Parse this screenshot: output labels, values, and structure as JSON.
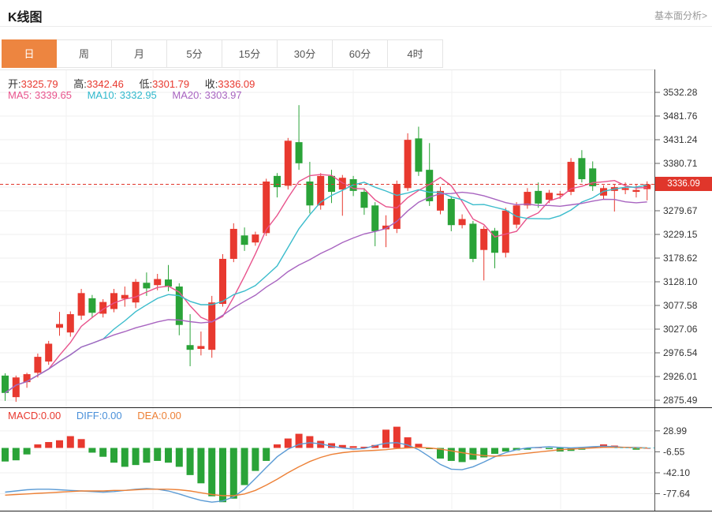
{
  "header": {
    "title": "K线图",
    "link": "基本面分析>"
  },
  "tabs": {
    "items": [
      {
        "label": "日",
        "active": true
      },
      {
        "label": "周",
        "active": false
      },
      {
        "label": "月",
        "active": false
      },
      {
        "label": "5分",
        "active": false
      },
      {
        "label": "15分",
        "active": false
      },
      {
        "label": "30分",
        "active": false
      },
      {
        "label": "60分",
        "active": false
      },
      {
        "label": "4时",
        "active": false
      }
    ]
  },
  "ohlc": {
    "open_label": "开:",
    "open_value": "3325.79",
    "high_label": "高:",
    "high_value": "3342.46",
    "low_label": "低:",
    "low_value": "3301.79",
    "close_label": "收:",
    "close_value": "3336.09"
  },
  "ma": {
    "ma5_label": "MA5:",
    "ma5_value": "3339.65",
    "ma10_label": "MA10:",
    "ma10_value": "3332.95",
    "ma20_label": "MA20:",
    "ma20_value": "3303.97"
  },
  "macd_info": {
    "macd_label": "MACD:",
    "macd_value": "0.00",
    "diff_label": "DIFF:",
    "diff_value": "0.00",
    "dea_label": "DEA:",
    "dea_value": "0.00"
  },
  "price_tag": "3336.09",
  "colors": {
    "up": "#e8392f",
    "down": "#2aa338",
    "ma5": "#e8538c",
    "ma10": "#3bbccc",
    "ma20": "#a864c0",
    "diff": "#5b9bd5",
    "dea": "#ed8137",
    "tab_accent": "#ED8540",
    "price_line": "#e0362b",
    "grid": "#efefef",
    "axis": "#666666",
    "zero_dash": "#62c9d8"
  },
  "chart_data": [
    {
      "type": "candlestick",
      "title": "K线图",
      "legend": [
        "MA5",
        "MA10",
        "MA20"
      ],
      "current_price": 3336.09,
      "x_gridlines": [
        84,
        194,
        304,
        448,
        573,
        711
      ],
      "y_ticks": [
        {
          "value": 3532.28,
          "label": "3532.28"
        },
        {
          "value": 3481.76,
          "label": "3481.76"
        },
        {
          "value": 3431.24,
          "label": "3431.24"
        },
        {
          "value": 3380.71,
          "label": "3380.71"
        },
        {
          "value": 3330.19,
          "label": ""
        },
        {
          "value": 3279.67,
          "label": "3279.67"
        },
        {
          "value": 3229.15,
          "label": "3229.15"
        },
        {
          "value": 3178.62,
          "label": "3178.62"
        },
        {
          "value": 3128.1,
          "label": "3128.10"
        },
        {
          "value": 3077.58,
          "label": "3077.58"
        },
        {
          "value": 3027.06,
          "label": "3027.06"
        },
        {
          "value": 2976.54,
          "label": "2976.54"
        },
        {
          "value": 2926.01,
          "label": "2926.01"
        },
        {
          "value": 2875.49,
          "label": "2875.49"
        }
      ],
      "candles_ohlc_hl_format": "[open, high, low, close]",
      "candles": [
        [
          2928,
          2933,
          2874,
          2891
        ],
        [
          2882,
          2928,
          2872,
          2924
        ],
        [
          2914,
          2934,
          2902,
          2931
        ],
        [
          2934,
          2975,
          2924,
          2968
        ],
        [
          2958,
          3002,
          2951,
          2996
        ],
        [
          3030,
          3064,
          3013,
          3038
        ],
        [
          3020,
          3065,
          3011,
          3059
        ],
        [
          3056,
          3113,
          3047,
          3104
        ],
        [
          3093,
          3100,
          3051,
          3062
        ],
        [
          3060,
          3091,
          3052,
          3085
        ],
        [
          3070,
          3113,
          3063,
          3104
        ],
        [
          3092,
          3118,
          3075,
          3100
        ],
        [
          3084,
          3134,
          3072,
          3128
        ],
        [
          3126,
          3148,
          3098,
          3114
        ],
        [
          3121,
          3145,
          3110,
          3134
        ],
        [
          3133,
          3164,
          3108,
          3118
        ],
        [
          3118,
          3125,
          3014,
          3036
        ],
        [
          2993,
          3059,
          2948,
          2983
        ],
        [
          2985,
          3022,
          2971,
          2991
        ],
        [
          2983,
          3098,
          2966,
          3084
        ],
        [
          3081,
          3187,
          3075,
          3177
        ],
        [
          3177,
          3253,
          3170,
          3241
        ],
        [
          3227,
          3244,
          3194,
          3207
        ],
        [
          3212,
          3235,
          3205,
          3229
        ],
        [
          3232,
          3348,
          3226,
          3342
        ],
        [
          3354,
          3360,
          3308,
          3330
        ],
        [
          3333,
          3435,
          3325,
          3429
        ],
        [
          3426,
          3505,
          3367,
          3381
        ],
        [
          3342,
          3384,
          3274,
          3291
        ],
        [
          3291,
          3360,
          3282,
          3354
        ],
        [
          3354,
          3367,
          3296,
          3320
        ],
        [
          3325,
          3356,
          3269,
          3350
        ],
        [
          3347,
          3354,
          3311,
          3322
        ],
        [
          3320,
          3328,
          3271,
          3286
        ],
        [
          3291,
          3298,
          3204,
          3236
        ],
        [
          3240,
          3270,
          3202,
          3248
        ],
        [
          3241,
          3344,
          3232,
          3337
        ],
        [
          3328,
          3445,
          3322,
          3431
        ],
        [
          3434,
          3459,
          3354,
          3363
        ],
        [
          3367,
          3424,
          3290,
          3300
        ],
        [
          3280,
          3331,
          3272,
          3322
        ],
        [
          3305,
          3311,
          3236,
          3249
        ],
        [
          3249,
          3272,
          3242,
          3262
        ],
        [
          3252,
          3258,
          3170,
          3177
        ],
        [
          3196,
          3247,
          3131,
          3241
        ],
        [
          3237,
          3243,
          3157,
          3190
        ],
        [
          3190,
          3286,
          3180,
          3280
        ],
        [
          3250,
          3298,
          3242,
          3291
        ],
        [
          3291,
          3328,
          3284,
          3320
        ],
        [
          3322,
          3340,
          3286,
          3295
        ],
        [
          3303,
          3324,
          3296,
          3318
        ],
        [
          3313,
          3322,
          3305,
          3316
        ],
        [
          3320,
          3392,
          3313,
          3384
        ],
        [
          3392,
          3409,
          3340,
          3347
        ],
        [
          3370,
          3385,
          3322,
          3332
        ],
        [
          3312,
          3334,
          3305,
          3328
        ],
        [
          3322,
          3337,
          3278,
          3330
        ],
        [
          3324,
          3340,
          3315,
          3328
        ],
        [
          3320,
          3336,
          3308,
          3324
        ],
        [
          3325.79,
          3342.46,
          3301.79,
          3336.09
        ]
      ]
    },
    {
      "type": "bar",
      "title": "MACD",
      "legend": [
        "MACD",
        "DIFF",
        "DEA"
      ],
      "y_ticks": [
        {
          "value": 28.99,
          "label": "28.99"
        },
        {
          "value": -6.55,
          "label": "-6.55"
        },
        {
          "value": -42.1,
          "label": "-42.10"
        },
        {
          "value": -77.64,
          "label": "-77.64"
        }
      ],
      "histogram": [
        -23,
        -21,
        -11,
        6,
        10,
        13,
        20,
        15,
        -8,
        -15,
        -25,
        -32,
        -29,
        -25,
        -22,
        -25,
        -32,
        -46,
        -60,
        -82,
        -92,
        -86,
        -63,
        -39,
        -22,
        6,
        16,
        24,
        20,
        12,
        8,
        5,
        3,
        2,
        5,
        31,
        36,
        18,
        7,
        -2,
        -18,
        -22,
        -24,
        -20,
        -16,
        -10,
        -6,
        -4,
        -3,
        1,
        -2,
        -6,
        -5,
        -3,
        2,
        6,
        4,
        2,
        -3,
        0
      ],
      "diff": [
        -75,
        -73,
        -71,
        -70,
        -70,
        -71,
        -72,
        -73,
        -74,
        -75,
        -74,
        -72,
        -70,
        -69,
        -70,
        -73,
        -78,
        -84,
        -89,
        -92,
        -90,
        -83,
        -70,
        -52,
        -33,
        -15,
        -2,
        6,
        9,
        7,
        3,
        0,
        -2,
        -1,
        4,
        8,
        9,
        5,
        -3,
        -15,
        -28,
        -36,
        -37,
        -32,
        -24,
        -15,
        -8,
        -3,
        0,
        1,
        2,
        1,
        0,
        1,
        2,
        3,
        2,
        1,
        1,
        0
      ],
      "dea": [
        -80,
        -79,
        -78,
        -77,
        -76,
        -75,
        -74,
        -73,
        -73,
        -73,
        -72,
        -72,
        -71,
        -70,
        -70,
        -70,
        -71,
        -73,
        -76,
        -79,
        -81,
        -81,
        -78,
        -72,
        -63,
        -53,
        -42,
        -32,
        -23,
        -16,
        -11,
        -8,
        -6,
        -5,
        -4,
        -3,
        -1,
        0,
        1,
        0,
        -2,
        -5,
        -8,
        -11,
        -13,
        -14,
        -13,
        -11,
        -9,
        -7,
        -5,
        -3,
        -2,
        -1,
        0,
        1,
        1,
        1,
        0,
        0
      ]
    }
  ]
}
